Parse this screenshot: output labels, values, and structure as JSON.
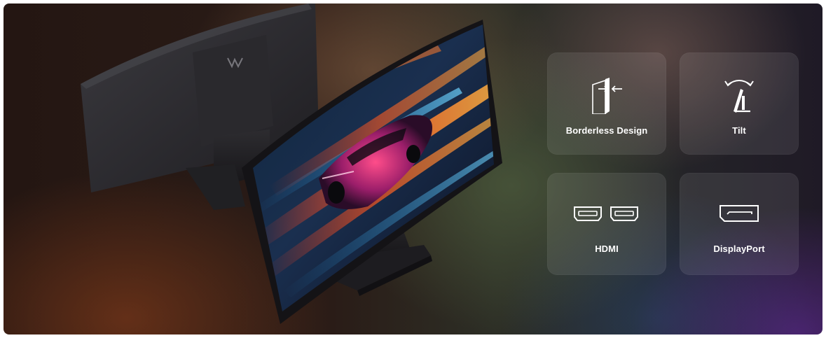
{
  "features": [
    {
      "label": "Borderless Design",
      "icon": "borderless-design-icon"
    },
    {
      "label": "Tilt",
      "icon": "tilt-icon"
    },
    {
      "label": "HDMI",
      "icon": "hdmi-port-icon"
    },
    {
      "label": "DisplayPort",
      "icon": "displayport-icon"
    }
  ],
  "colors": {
    "card_text": "#ffffff",
    "card_background": "rgba(255,255,255,0.09)",
    "background_dark": "#241612"
  }
}
